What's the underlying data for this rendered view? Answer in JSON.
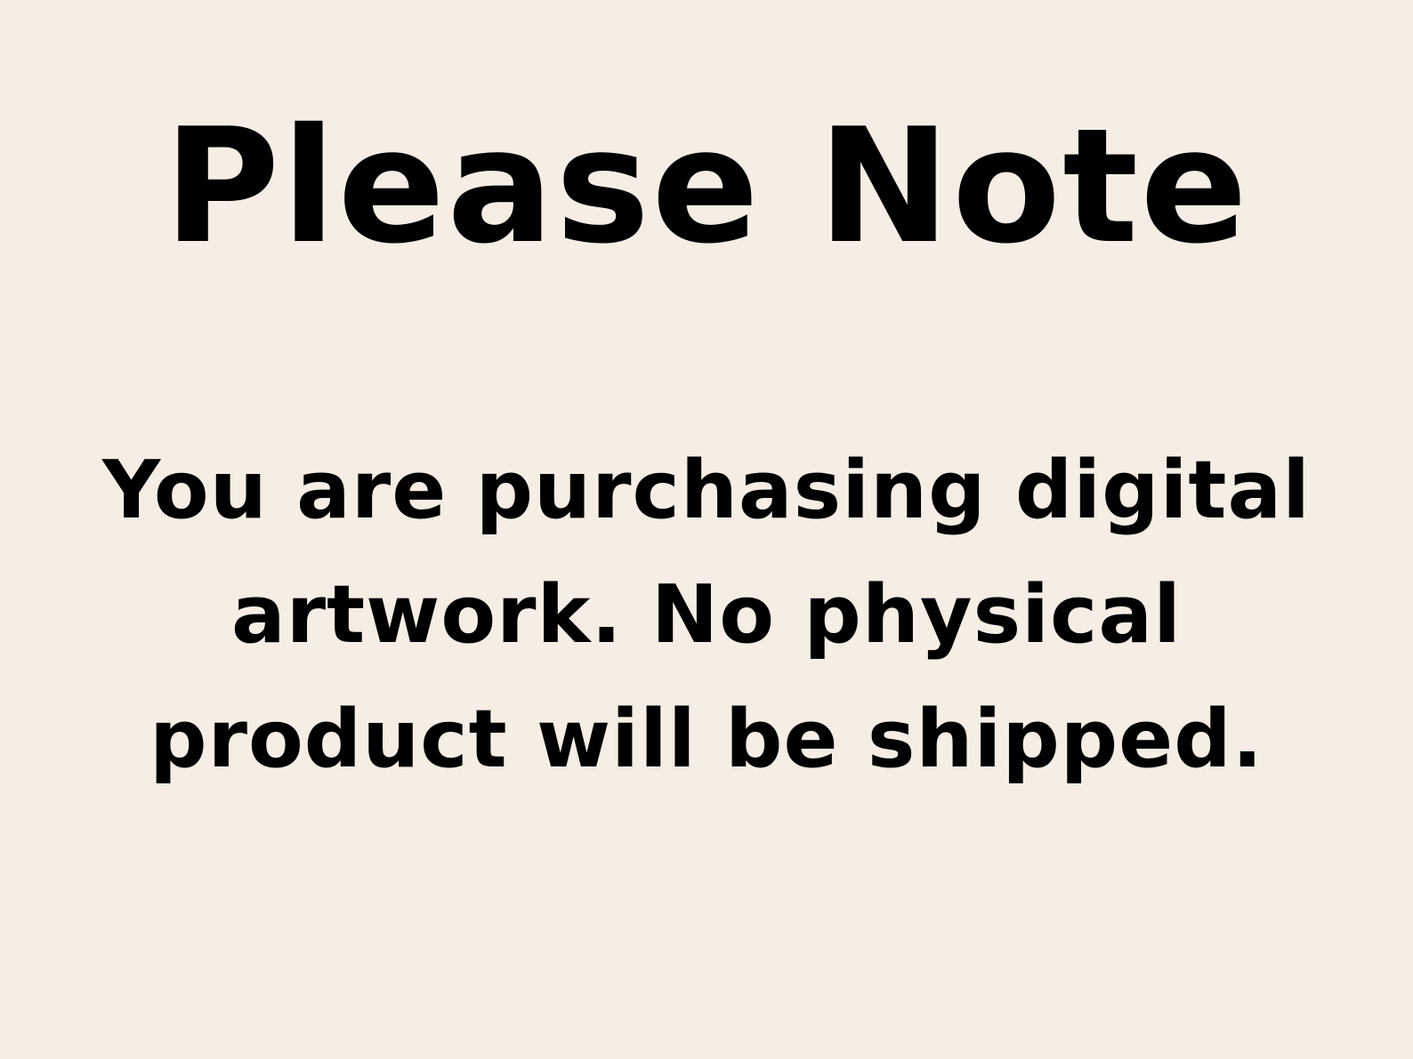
{
  "background_color": "#f6eee5",
  "text_color": "#000000",
  "title": "Please Note",
  "message": {
    "line_1": "You are purchasing digital",
    "line_2": "artwork. No physical",
    "line_3": "product will be shipped."
  }
}
